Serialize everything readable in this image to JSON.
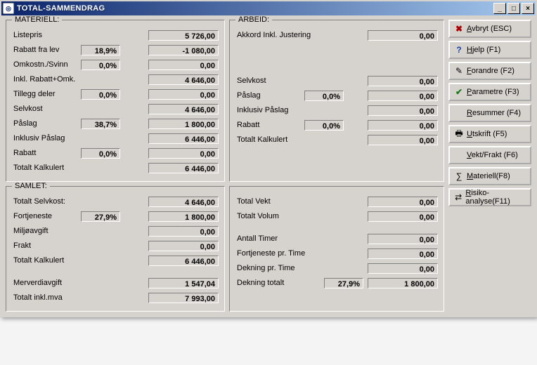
{
  "window": {
    "title": "TOTAL-SAMMENDRAG"
  },
  "materiell": {
    "legend": "MATERIELL:",
    "rows": {
      "listepris": {
        "label": "Listepris",
        "pct": "",
        "val": "5 726,00"
      },
      "rabatt_lev": {
        "label": "Rabatt fra lev",
        "pct": "18,9%",
        "val": "-1 080,00"
      },
      "omkostn": {
        "label": "Omkostn./Svinn",
        "pct": "0,0%",
        "val": "0,00"
      },
      "inkl_rabatt": {
        "label": "Inkl. Rabatt+Omk.",
        "pct": "",
        "val": "4 646,00"
      },
      "tillegg": {
        "label": "Tillegg deler",
        "pct": "0,0%",
        "val": "0,00"
      },
      "selvkost": {
        "label": "Selvkost",
        "pct": "",
        "val": "4 646,00"
      },
      "paaslag": {
        "label": "Påslag",
        "pct": "38,7%",
        "val": "1 800,00"
      },
      "inkl_paaslag": {
        "label": "Inklusiv Påslag",
        "pct": "",
        "val": "6 446,00"
      },
      "rabatt": {
        "label": "Rabatt",
        "pct": "0,0%",
        "val": "0,00"
      },
      "totalt_kalk": {
        "label": "Totalt Kalkulert",
        "pct": "",
        "val": "6 446,00"
      }
    }
  },
  "arbeid": {
    "legend": "ARBEID:",
    "rows": {
      "akkord": {
        "label": "Akkord Inkl. Justering",
        "pct": "",
        "val": "0,00"
      },
      "selvkost": {
        "label": "Selvkost",
        "pct": "",
        "val": "0,00"
      },
      "paaslag": {
        "label": "Påslag",
        "pct": "0,0%",
        "val": "0,00"
      },
      "inkl_paaslag": {
        "label": "Inklusiv Påslag",
        "pct": "",
        "val": "0,00"
      },
      "rabatt": {
        "label": "Rabatt",
        "pct": "0,0%",
        "val": "0,00"
      },
      "totalt_kalk": {
        "label": "Totalt Kalkulert",
        "pct": "",
        "val": "0,00"
      }
    }
  },
  "samlet": {
    "legend": "SAMLET:",
    "rows": {
      "tot_selvkost": {
        "label": "Totalt Selvkost:",
        "pct": "",
        "val": "4 646,00"
      },
      "fortjeneste": {
        "label": "Fortjeneste",
        "pct": "27,9%",
        "val": "1 800,00"
      },
      "miljo": {
        "label": "Miljøavgift",
        "pct": "",
        "val": "0,00"
      },
      "frakt": {
        "label": "Frakt",
        "pct": "",
        "val": "0,00"
      },
      "tot_kalk": {
        "label": "Totalt Kalkulert",
        "pct": "",
        "val": "6 446,00"
      },
      "mva": {
        "label": "Merverdiavgift",
        "pct": "",
        "val": "1 547,04"
      },
      "tot_inkl_mva": {
        "label": "Totalt inkl.mva",
        "pct": "",
        "val": "7 993,00"
      }
    }
  },
  "metrics": {
    "legend": "",
    "rows": {
      "vekt": {
        "label": "Total Vekt",
        "pct": "",
        "val": "0,00"
      },
      "volum": {
        "label": "Totalt Volum",
        "pct": "",
        "val": "0,00"
      },
      "timer": {
        "label": "Antall Timer",
        "pct": "",
        "val": "0,00"
      },
      "ft_time": {
        "label": "Fortjeneste pr. Time",
        "pct": "",
        "val": "0,00"
      },
      "dk_time": {
        "label": "Dekning pr. Time",
        "pct": "",
        "val": "0,00"
      },
      "dk_tot": {
        "label": "Dekning totalt",
        "pct": "27,9%",
        "val": "1 800,00"
      }
    }
  },
  "buttons": {
    "avbryt": {
      "label": "Avbryt (ESC)",
      "key": "A"
    },
    "hjelp": {
      "label": "Hjelp (F1)",
      "key": "H"
    },
    "forandre": {
      "label": "Forandre (F2)",
      "key": "F"
    },
    "parametre": {
      "label": "Parametre (F3)",
      "key": "P"
    },
    "resummer": {
      "label": "Resummer (F4)",
      "key": "R"
    },
    "utskrift": {
      "label": "Utskrift (F5)",
      "key": "U"
    },
    "vekt": {
      "label": "Vekt/Frakt (F6)",
      "key": "V"
    },
    "materiell": {
      "label": "Materiell(F8)",
      "key": "M"
    },
    "risiko": {
      "label": "Risiko-analyse(F11)",
      "key": "R"
    }
  }
}
